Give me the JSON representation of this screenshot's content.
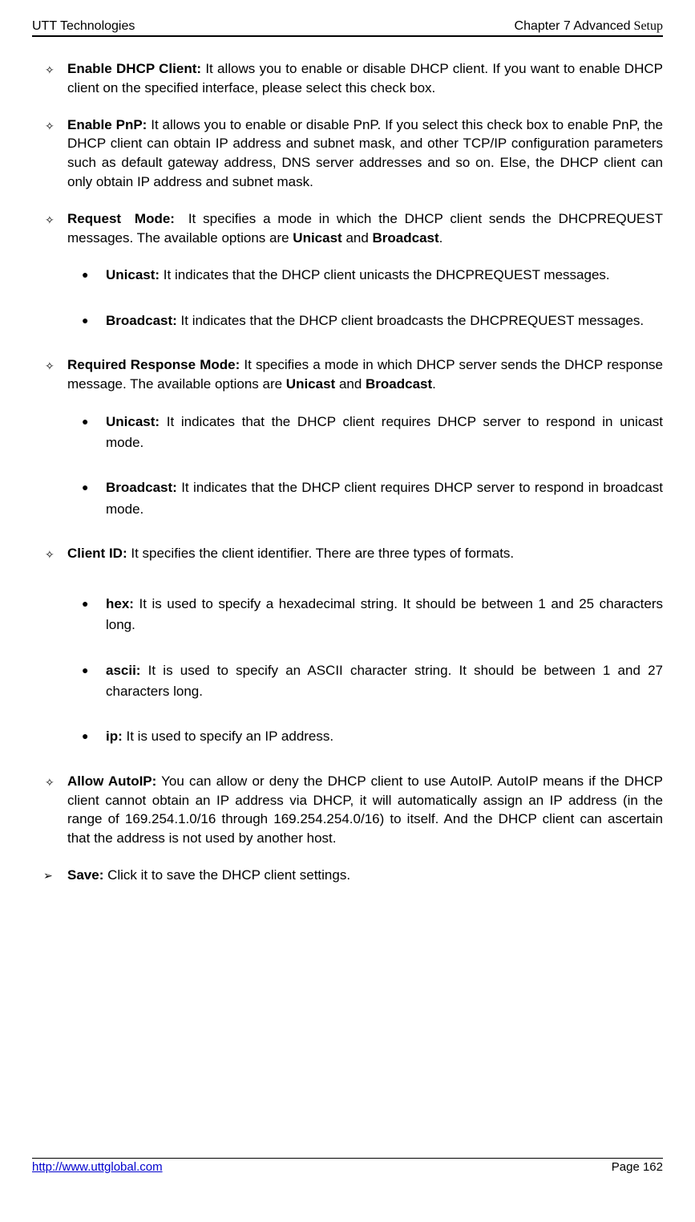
{
  "header": {
    "left": "UTT Technologies",
    "right_prefix": "Chapter 7 Advanced",
    "right_suffix": " Setup"
  },
  "items": [
    {
      "type": "diamond",
      "label": "Enable DHCP Client:",
      "label_space": " ",
      "text": "It allows you to enable or disable DHCP client. If you want to enable DHCP client on the specified interface, please select this check box.",
      "gap": ""
    },
    {
      "type": "diamond",
      "label": "Enable PnP:",
      "label_space": " ",
      "text": "It allows you to enable or disable PnP. If you select this check box to enable PnP, the DHCP client can obtain IP address and subnet mask, and other TCP/IP configuration parameters such as default gateway address, DNS server addresses and so on. Else, the DHCP client can only obtain IP address and subnet mask.",
      "gap": ""
    },
    {
      "type": "diamond",
      "label": "Request Mode:",
      "label_space": " ",
      "text_a": "It specifies a mode in which the DHCP client sends the DHCPREQUEST messages. The available options are ",
      "bold_a": "Unicast",
      "mid": " and ",
      "bold_b": "Broadcast",
      "tail": ".",
      "gap": "gap-xl"
    },
    {
      "type": "bullet",
      "label": "Unicast:",
      "text": " It indicates that the DHCP client unicasts the DHCPREQUEST messages.",
      "gap": "gap-lg"
    },
    {
      "type": "bullet",
      "label": "Broadcast:",
      "text": " It indicates that the DHCP client broadcasts the DHCPREQUEST messages.",
      "gap": ""
    },
    {
      "type": "diamond",
      "label": "Required Response Mode:",
      "label_space": " ",
      "text_a": "It specifies a mode in which DHCP server sends the DHCP response message. The available options are ",
      "bold_a": "Unicast",
      "mid": " and ",
      "bold_b": "Broadcast",
      "tail": ".",
      "gap": ""
    },
    {
      "type": "bullet",
      "label": "Unicast:",
      "text": " It indicates that the DHCP client requires DHCP server to respond in unicast mode.",
      "gap": ""
    },
    {
      "type": "bullet",
      "label": "Broadcast:",
      "text": " It indicates that the DHCP client requires DHCP server to respond in broadcast mode.",
      "gap": ""
    },
    {
      "type": "diamond",
      "label": "Client ID:",
      "label_space": " ",
      "text": "It specifies the client identifier. There are three types of formats.",
      "gap": "",
      "extra_bottom": true
    },
    {
      "type": "bullet",
      "label": "hex:",
      "text": " It is used to specify a hexadecimal string. It should be between 1 and 25 characters long.",
      "gap": ""
    },
    {
      "type": "bullet",
      "label": "ascii:",
      "text": " It is used to specify an ASCII character string. It should be between 1 and 27 characters long.",
      "gap": ""
    },
    {
      "type": "bullet",
      "label": "ip:",
      "text": " It is used to specify an IP address.",
      "gap": ""
    },
    {
      "type": "diamond",
      "label": "Allow AutoIP:",
      "label_space": " ",
      "text": "You can allow or deny the DHCP client to use AutoIP. AutoIP means if the DHCP client cannot obtain an IP address via DHCP, it will automatically assign an IP address (in the range of 169.254.1.0/16 through 169.254.254.0/16) to itself. And the DHCP client can ascertain that the address is not used by another host.",
      "gap": ""
    },
    {
      "type": "triangle",
      "label": "Save:",
      "text": " Click it to save the DHCP client settings."
    }
  ],
  "footer": {
    "link": "http://www.uttglobal.com",
    "page": "Page 162"
  }
}
